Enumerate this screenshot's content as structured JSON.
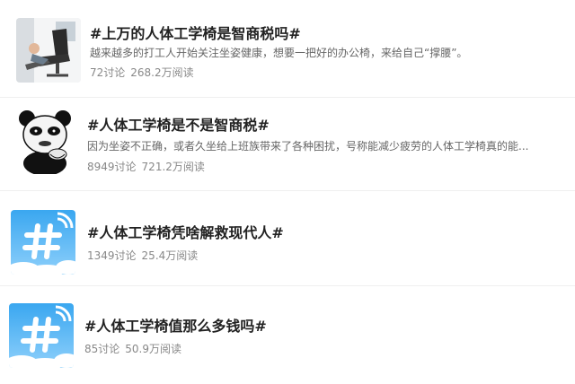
{
  "topics": [
    {
      "title": "#上万的人体工学椅是智商税吗#",
      "description": "越来越多的打工人开始关注坐姿健康，想要一把好的办公椅，来给自己“撑腰”。",
      "discussions": "72讨论",
      "reads": "268.2万阅读",
      "thumbnail": "office-chair-photo"
    },
    {
      "title": "#人体工学椅是不是智商税#",
      "description": "因为坐姿不正确，或者久坐给上班族带来了各种困扰，号称能减少疲劳的人体工学椅真的能...",
      "discussions": "8949讨论",
      "reads": "721.2万阅读",
      "thumbnail": "panda-meme"
    },
    {
      "title": "#人体工学椅凭啥解救现代人#",
      "discussions": "1349讨论",
      "reads": "25.4万阅读",
      "thumbnail": "hashtag-icon"
    },
    {
      "title": "#人体工学椅值那么多钱吗#",
      "discussions": "85讨论",
      "reads": "50.9万阅读",
      "thumbnail": "hashtag-icon"
    }
  ],
  "colors": {
    "hashtag_bg_top": "#3aa7f0",
    "hashtag_bg_bottom": "#8fd0fb",
    "title": "#222222",
    "meta": "#888888"
  }
}
